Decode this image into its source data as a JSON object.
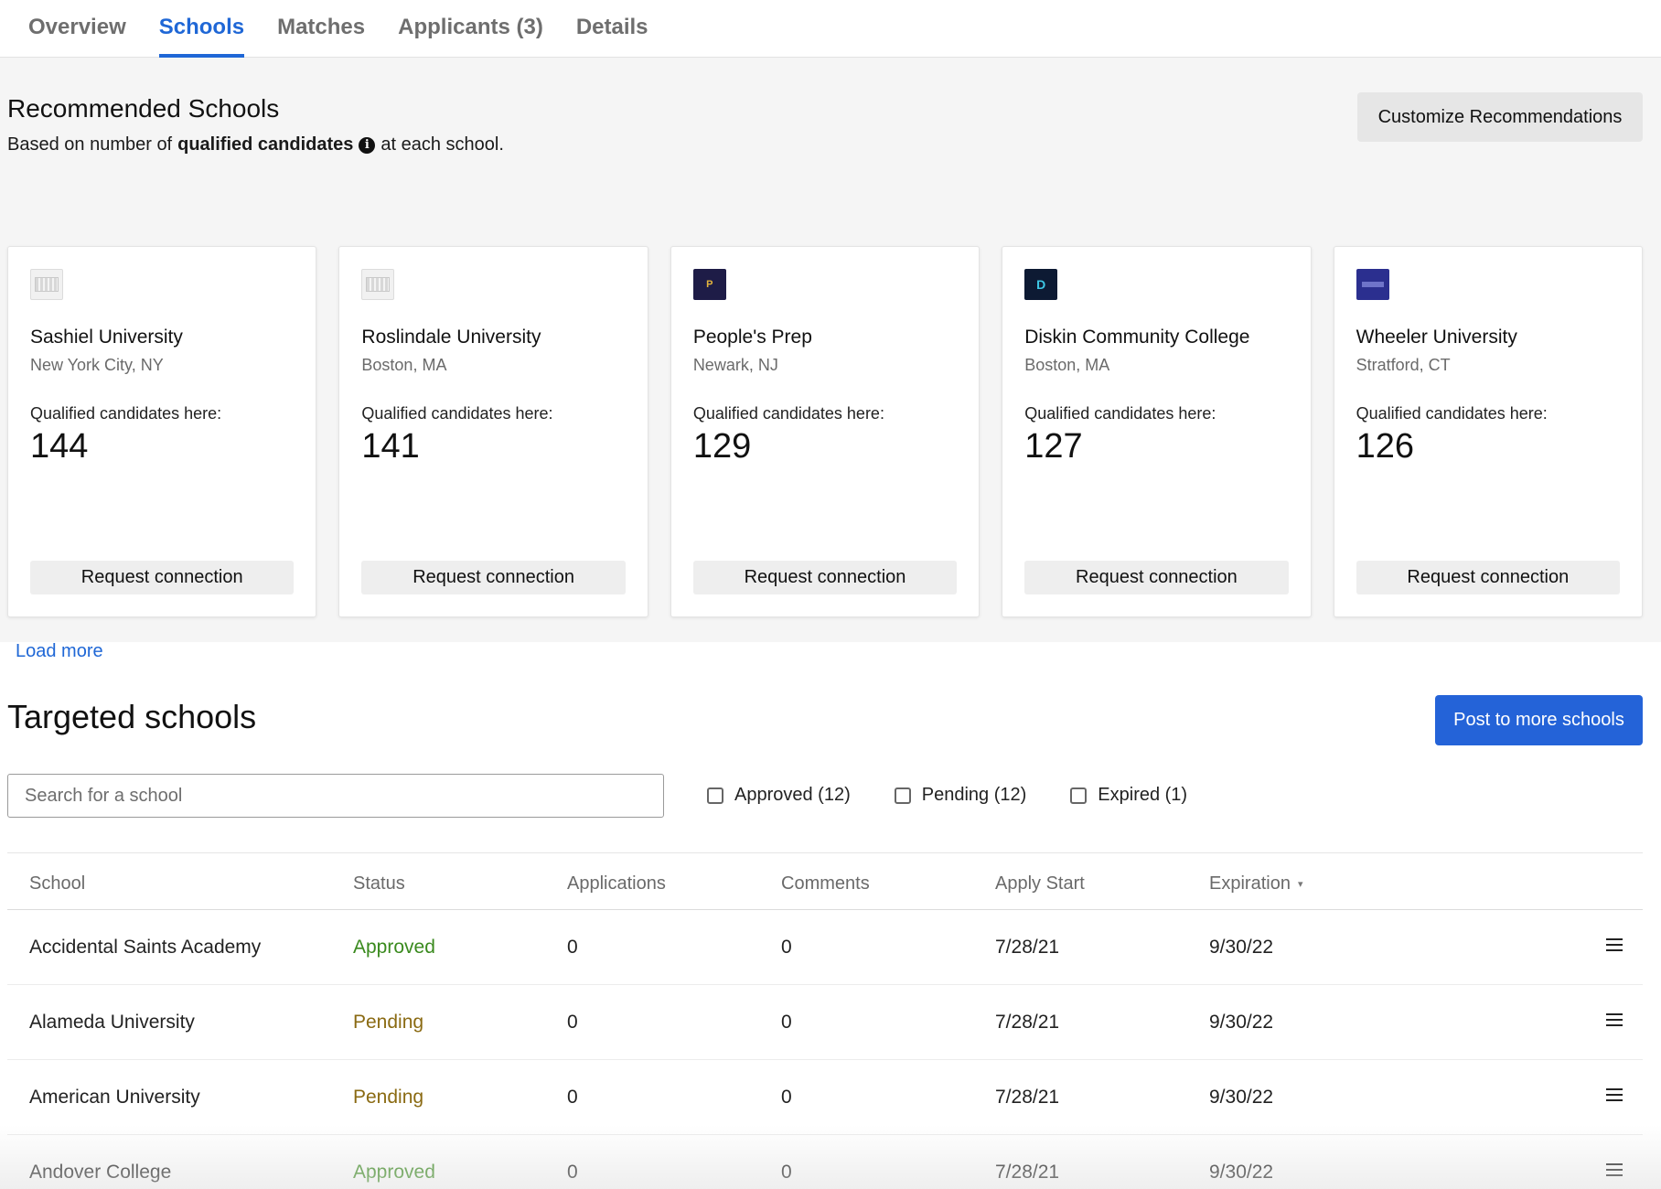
{
  "tabs": [
    {
      "label": "Overview",
      "active": false
    },
    {
      "label": "Schools",
      "active": true
    },
    {
      "label": "Matches",
      "active": false
    },
    {
      "label": "Applicants (3)",
      "active": false
    },
    {
      "label": "Details",
      "active": false
    }
  ],
  "recommended": {
    "title": "Recommended Schools",
    "subtitle_prefix": "Based on number of",
    "subtitle_bold": "qualified candidates",
    "subtitle_suffix": "at each school.",
    "info_icon": "info-circle-icon",
    "customize_label": "Customize Recommendations",
    "load_more_label": "Load more",
    "cards": [
      {
        "name": "Sashiel University",
        "location": "New York City, NY",
        "qc_label": "Qualified candidates here:",
        "count": "144",
        "button": "Request connection",
        "logo": "placeholder"
      },
      {
        "name": "Roslindale University",
        "location": "Boston, MA",
        "qc_label": "Qualified candidates here:",
        "count": "141",
        "button": "Request connection",
        "logo": "placeholder"
      },
      {
        "name": "People's Prep",
        "location": "Newark, NJ",
        "qc_label": "Qualified candidates here:",
        "count": "129",
        "button": "Request connection",
        "logo": "p"
      },
      {
        "name": "Diskin Community College",
        "location": "Boston, MA",
        "qc_label": "Qualified candidates here:",
        "count": "127",
        "button": "Request connection",
        "logo": "d"
      },
      {
        "name": "Wheeler University",
        "location": "Stratford, CT",
        "qc_label": "Qualified candidates here:",
        "count": "126",
        "button": "Request connection",
        "logo": "w"
      }
    ]
  },
  "targeted": {
    "title": "Targeted schools",
    "post_label": "Post to more schools",
    "search_placeholder": "Search for a school",
    "filters": [
      {
        "label": "Approved (12)",
        "checked": false
      },
      {
        "label": "Pending (12)",
        "checked": false
      },
      {
        "label": "Expired (1)",
        "checked": false
      }
    ],
    "columns": [
      "School",
      "Status",
      "Applications",
      "Comments",
      "Apply Start",
      "Expiration"
    ],
    "rows": [
      {
        "school": "Accidental Saints Academy",
        "status": "Approved",
        "applications": "0",
        "comments": "0",
        "apply_start": "7/28/21",
        "expiration": "9/30/22"
      },
      {
        "school": "Alameda University",
        "status": "Pending",
        "applications": "0",
        "comments": "0",
        "apply_start": "7/28/21",
        "expiration": "9/30/22"
      },
      {
        "school": "American University",
        "status": "Pending",
        "applications": "0",
        "comments": "0",
        "apply_start": "7/28/21",
        "expiration": "9/30/22"
      },
      {
        "school": "Andover College",
        "status": "Approved",
        "applications": "0",
        "comments": "0",
        "apply_start": "7/28/21",
        "expiration": "9/30/22"
      }
    ]
  },
  "colors": {
    "accent": "#1f67d6",
    "approved": "#3a8a1e",
    "pending": "#8a6a12"
  }
}
